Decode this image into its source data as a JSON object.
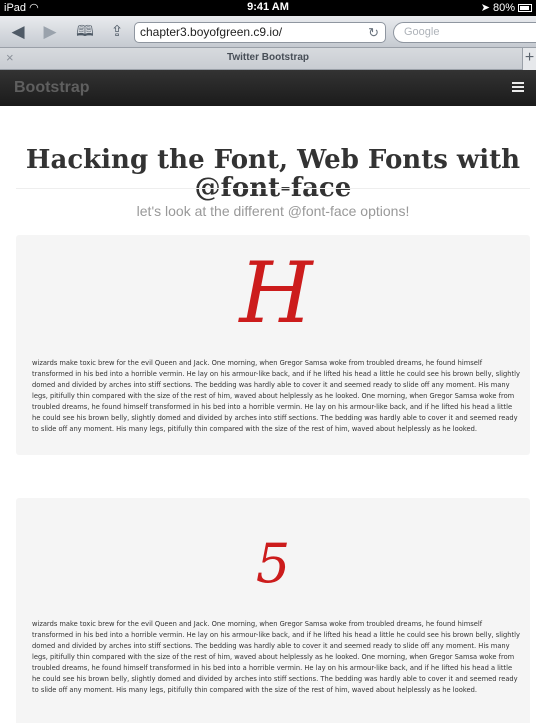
{
  "status_bar": {
    "device": "iPad",
    "time": "9:41 AM",
    "battery": "80%"
  },
  "browser": {
    "url": "chapter3.boyofgreen.c9.io/",
    "search_placeholder": "Google",
    "tab_title": "Twitter Bootstrap",
    "tab_close": "×",
    "new_tab": "+"
  },
  "navbar": {
    "brand": "Bootstrap"
  },
  "page": {
    "title": "Hacking the Font, Web Fonts with @font-face",
    "subtitle": "let's look at the different @font-face options!"
  },
  "samples": [
    {
      "glyph": "H",
      "text": "wizards make toxic brew for the evil Queen and Jack. One morning, when Gregor Samsa woke from troubled dreams, he found himself transformed in his bed into a horrible vermin. He lay on his armour-like back, and if he lifted his head a little he could see his brown belly, slightly domed and divided by arches into stiff sections. The bedding was hardly able to cover it and seemed ready to slide off any moment. His many legs, pitifully thin compared with the size of the rest of him, waved about helplessly as he looked. One morning, when Gregor Samsa woke from troubled dreams, he found himself transformed in his bed into a horrible vermin. He lay on his armour-like back, and if he lifted his head a little he could see his brown belly, slightly domed and divided by arches into stiff sections. The bedding was hardly able to cover it and seemed ready to slide off any moment. His many legs, pitifully thin compared with the size of the rest of him, waved about helplessly as he looked."
    },
    {
      "glyph": "5",
      "text": "wizards make toxic brew for the evil Queen and Jack. One morning, when Gregor Samsa woke from troubled dreams, he found himself transformed in his bed into a horrible vermin. He lay on his armour-like back, and if he lifted his head a little he could see his brown belly, slightly domed and divided by arches into stiff sections. The bedding was hardly able to cover it and seemed ready to slide off any moment. His many legs, pitifully thin compared with the size of the rest of him, waved about helplessly as he looked. One morning, when Gregor Samsa woke from troubled dreams, he found himself transformed in his bed into a horrible vermin. He lay on his armour-like back, and if he lifted his head a little he could see his brown belly, slightly domed and divided by arches into stiff sections. The bedding was hardly able to cover it and seemed ready to slide off any moment. His many legs, pitifully thin compared with the size of the rest of him, waved about helplessly as he looked."
    }
  ],
  "colors": {
    "glyph_red": "#cc1c1c",
    "navbar_bg": "#222222",
    "well_bg": "#f5f5f5"
  }
}
